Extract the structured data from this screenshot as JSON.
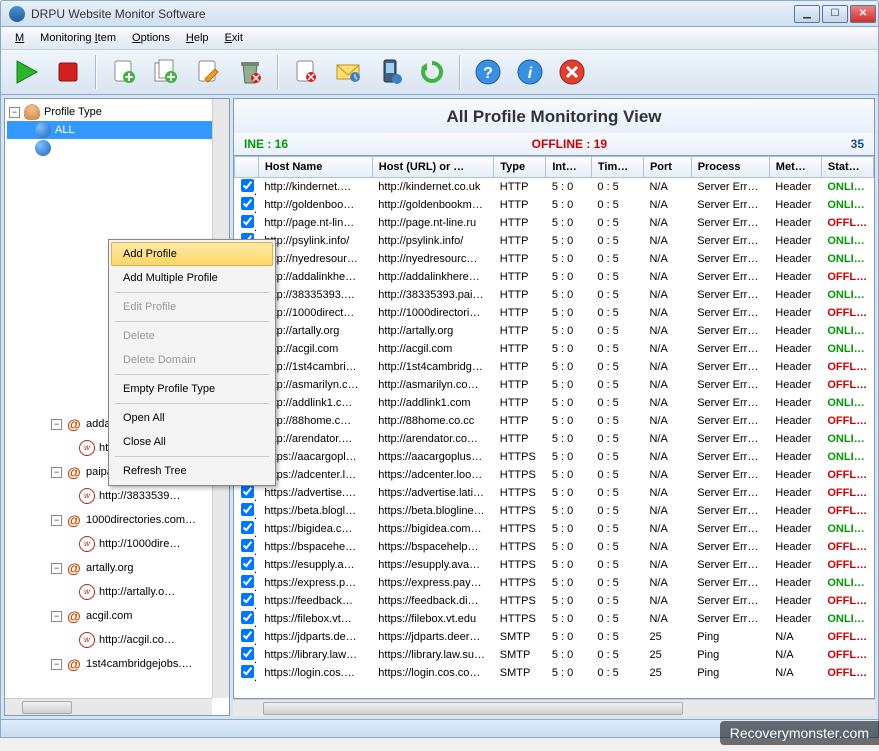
{
  "window": {
    "title": "DRPU Website Monitor Software"
  },
  "menu": {
    "monitoring": "Monitoring",
    "monitoringitem": "Monitoring Item",
    "options": "Options",
    "help": "Help",
    "exit": "Exit"
  },
  "header": {
    "title": "All Profile Monitoring View"
  },
  "status": {
    "online_label": "INE : 16",
    "offline_label": "OFFLINE : 19",
    "total": "35"
  },
  "columns": {
    "chk": "",
    "host": "Host Name",
    "url": "Host (URL) or …",
    "type": "Type",
    "int": "Int…",
    "tim": "Tim…",
    "port": "Port",
    "proc": "Process",
    "met": "Met…",
    "stat": "Stat…"
  },
  "context": {
    "add_profile": "Add Profile",
    "add_multiple": "Add Multiple Profile",
    "edit_profile": "Edit Profile",
    "delete": "Delete",
    "delete_domain": "Delete Domain",
    "empty": "Empty Profile Type",
    "open_all": "Open All",
    "close_all": "Close All",
    "refresh": "Refresh Tree"
  },
  "tree": {
    "root": "Profile Type",
    "all": "ALL",
    "items": [
      "addalinkhere.com",
      "http://addalink…",
      "paipai.com",
      "http://3833539…",
      "1000directories.com…",
      "http://1000dire…",
      "artally.org",
      "http://artally.o…",
      "acgil.com",
      "http://acgil.co…",
      "1st4cambridgejobs.…"
    ]
  },
  "rows": [
    {
      "host": "http://kindernet.…",
      "url": "http://kindernet.co.uk",
      "type": "HTTP",
      "int": "5 : 0",
      "tim": "0 : 5",
      "port": "N/A",
      "proc": "Server Erro…",
      "met": "Header",
      "stat": "ONLI…"
    },
    {
      "host": "http://goldenboo…",
      "url": "http://goldenbookm…",
      "type": "HTTP",
      "int": "5 : 0",
      "tim": "0 : 5",
      "port": "N/A",
      "proc": "Server Erro…",
      "met": "Header",
      "stat": "ONLI…"
    },
    {
      "host": "http://page.nt-lin…",
      "url": "http://page.nt-line.ru",
      "type": "HTTP",
      "int": "5 : 0",
      "tim": "0 : 5",
      "port": "N/A",
      "proc": "Server Erro…",
      "met": "Header",
      "stat": "OFFL…"
    },
    {
      "host": "http://psylink.info/",
      "url": "http://psylink.info/",
      "type": "HTTP",
      "int": "5 : 0",
      "tim": "0 : 5",
      "port": "N/A",
      "proc": "Server Erro…",
      "met": "Header",
      "stat": "ONLI…"
    },
    {
      "host": "http://nyedresour…",
      "url": "http://nyedresourc…",
      "type": "HTTP",
      "int": "5 : 0",
      "tim": "0 : 5",
      "port": "N/A",
      "proc": "Server Erro…",
      "met": "Header",
      "stat": "ONLI…"
    },
    {
      "host": "http://addalinkhe…",
      "url": "http://addalinkhere…",
      "type": "HTTP",
      "int": "5 : 0",
      "tim": "0 : 5",
      "port": "N/A",
      "proc": "Server Erro…",
      "met": "Header",
      "stat": "OFFL…"
    },
    {
      "host": "http://38335393.…",
      "url": "http://38335393.pai…",
      "type": "HTTP",
      "int": "5 : 0",
      "tim": "0 : 5",
      "port": "N/A",
      "proc": "Server Erro…",
      "met": "Header",
      "stat": "ONLI…"
    },
    {
      "host": "http://1000direct…",
      "url": "http://1000directori…",
      "type": "HTTP",
      "int": "5 : 0",
      "tim": "0 : 5",
      "port": "N/A",
      "proc": "Server Erro…",
      "met": "Header",
      "stat": "OFFL…"
    },
    {
      "host": "http://artally.org",
      "url": "http://artally.org",
      "type": "HTTP",
      "int": "5 : 0",
      "tim": "0 : 5",
      "port": "N/A",
      "proc": "Server Erro…",
      "met": "Header",
      "stat": "ONLI…"
    },
    {
      "host": "http://acgil.com",
      "url": "http://acgil.com",
      "type": "HTTP",
      "int": "5 : 0",
      "tim": "0 : 5",
      "port": "N/A",
      "proc": "Server Erro…",
      "met": "Header",
      "stat": "ONLI…"
    },
    {
      "host": "http://1st4cambri…",
      "url": "http://1st4cambridg…",
      "type": "HTTP",
      "int": "5 : 0",
      "tim": "0 : 5",
      "port": "N/A",
      "proc": "Server Erro…",
      "met": "Header",
      "stat": "OFFL…"
    },
    {
      "host": "http://asmarilyn.c…",
      "url": "http://asmarilyn.co…",
      "type": "HTTP",
      "int": "5 : 0",
      "tim": "0 : 5",
      "port": "N/A",
      "proc": "Server Erro…",
      "met": "Header",
      "stat": "OFFL…"
    },
    {
      "host": "http://addlink1.c…",
      "url": "http://addlink1.com",
      "type": "HTTP",
      "int": "5 : 0",
      "tim": "0 : 5",
      "port": "N/A",
      "proc": "Server Erro…",
      "met": "Header",
      "stat": "ONLI…"
    },
    {
      "host": "http://88home.c…",
      "url": "http://88home.co.cc",
      "type": "HTTP",
      "int": "5 : 0",
      "tim": "0 : 5",
      "port": "N/A",
      "proc": "Server Erro…",
      "met": "Header",
      "stat": "OFFL…"
    },
    {
      "host": "http://arendator.…",
      "url": "http://arendator.co…",
      "type": "HTTP",
      "int": "5 : 0",
      "tim": "0 : 5",
      "port": "N/A",
      "proc": "Server Erro…",
      "met": "Header",
      "stat": "ONLI…"
    },
    {
      "host": "https://aacargopl…",
      "url": "https://aacargoplus…",
      "type": "HTTPS",
      "int": "5 : 0",
      "tim": "0 : 5",
      "port": "N/A",
      "proc": "Server Erro…",
      "met": "Header",
      "stat": "ONLI…"
    },
    {
      "host": "https://adcenter.l…",
      "url": "https://adcenter.loo…",
      "type": "HTTPS",
      "int": "5 : 0",
      "tim": "0 : 5",
      "port": "N/A",
      "proc": "Server Erro…",
      "met": "Header",
      "stat": "OFFL…"
    },
    {
      "host": "https://advertise.…",
      "url": "https://advertise.lati…",
      "type": "HTTPS",
      "int": "5 : 0",
      "tim": "0 : 5",
      "port": "N/A",
      "proc": "Server Erro…",
      "met": "Header",
      "stat": "OFFL…"
    },
    {
      "host": "https://beta.blogl…",
      "url": "https://beta.blogline…",
      "type": "HTTPS",
      "int": "5 : 0",
      "tim": "0 : 5",
      "port": "N/A",
      "proc": "Server Erro…",
      "met": "Header",
      "stat": "OFFL…"
    },
    {
      "host": "https://bigidea.c…",
      "url": "https://bigidea.com…",
      "type": "HTTPS",
      "int": "5 : 0",
      "tim": "0 : 5",
      "port": "N/A",
      "proc": "Server Erro…",
      "met": "Header",
      "stat": "ONLI…"
    },
    {
      "host": "https://bspacehe…",
      "url": "https://bspacehelp…",
      "type": "HTTPS",
      "int": "5 : 0",
      "tim": "0 : 5",
      "port": "N/A",
      "proc": "Server Erro…",
      "met": "Header",
      "stat": "OFFL…"
    },
    {
      "host": "https://esupply.a…",
      "url": "https://esupply.ava…",
      "type": "HTTPS",
      "int": "5 : 0",
      "tim": "0 : 5",
      "port": "N/A",
      "proc": "Server Erro…",
      "met": "Header",
      "stat": "OFFL…"
    },
    {
      "host": "https://express.p…",
      "url": "https://express.pay…",
      "type": "HTTPS",
      "int": "5 : 0",
      "tim": "0 : 5",
      "port": "N/A",
      "proc": "Server Erro…",
      "met": "Header",
      "stat": "ONLI…"
    },
    {
      "host": "https://feedback…",
      "url": "https://feedback.di…",
      "type": "HTTPS",
      "int": "5 : 0",
      "tim": "0 : 5",
      "port": "N/A",
      "proc": "Server Erro…",
      "met": "Header",
      "stat": "OFFL…"
    },
    {
      "host": "https://filebox.vt…",
      "url": "https://filebox.vt.edu",
      "type": "HTTPS",
      "int": "5 : 0",
      "tim": "0 : 5",
      "port": "N/A",
      "proc": "Server Erro…",
      "met": "Header",
      "stat": "ONLI…"
    },
    {
      "host": "https://jdparts.de…",
      "url": "https://jdparts.deer…",
      "type": "SMTP",
      "int": "5 : 0",
      "tim": "0 : 5",
      "port": "25",
      "proc": "Ping",
      "met": "N/A",
      "stat": "OFFL…"
    },
    {
      "host": "https://library.law…",
      "url": "https://library.law.su…",
      "type": "SMTP",
      "int": "5 : 0",
      "tim": "0 : 5",
      "port": "25",
      "proc": "Ping",
      "met": "N/A",
      "stat": "OFFL…"
    },
    {
      "host": "https://login.cos.…",
      "url": "https://login.cos.co…",
      "type": "SMTP",
      "int": "5 : 0",
      "tim": "0 : 5",
      "port": "25",
      "proc": "Ping",
      "met": "N/A",
      "stat": "OFFL…"
    }
  ],
  "watermark": "Recoverymonster.com"
}
